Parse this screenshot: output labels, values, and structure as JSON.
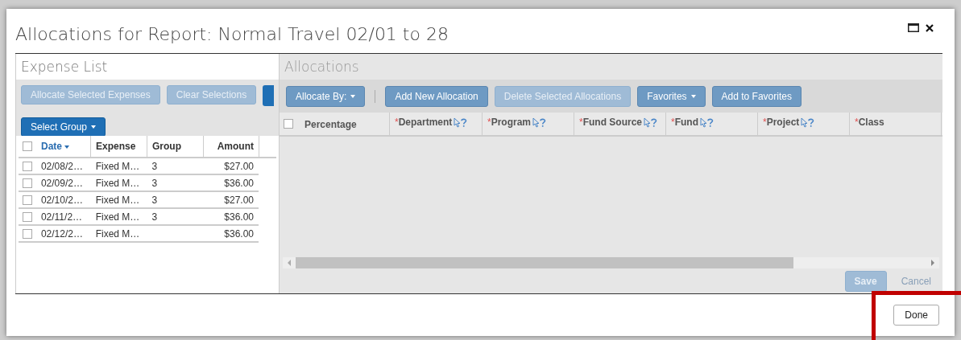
{
  "dialog": {
    "title": "Allocations for Report: Normal Travel 02/01 to 28",
    "expense_list": {
      "heading": "Expense List",
      "buttons": [
        {
          "label": "Allocate Selected Expenses",
          "disabled": true
        },
        {
          "label": "Clear Selections",
          "disabled": true
        }
      ],
      "select_group": {
        "label": "Select Group"
      },
      "all_checked": false,
      "columns": [
        {
          "label": "Date",
          "sorted": true
        },
        {
          "label": "Expense",
          "sorted": false
        },
        {
          "label": "Group",
          "sorted": false
        },
        {
          "label": "Amount",
          "sorted": false
        }
      ],
      "rows": [
        {
          "checked": false,
          "cells": [
            "02/08/2…",
            "Fixed M…",
            "3",
            "$27.00"
          ]
        },
        {
          "checked": false,
          "cells": [
            "02/09/2…",
            "Fixed M…",
            "3",
            "$36.00"
          ]
        },
        {
          "checked": false,
          "cells": [
            "02/10/2…",
            "Fixed M…",
            "3",
            "$27.00"
          ]
        },
        {
          "checked": false,
          "cells": [
            "02/11/2…",
            "Fixed M…",
            "3",
            "$36.00"
          ]
        },
        {
          "checked": false,
          "cells": [
            "02/12/2…",
            "Fixed M…",
            "",
            "$36.00"
          ]
        }
      ]
    },
    "allocations": {
      "heading": "Allocations",
      "toolbar": [
        {
          "kind": "dropdown",
          "label": "Allocate By:",
          "disabled": false,
          "separator_after": true
        },
        {
          "kind": "button",
          "label": "Add New Allocation",
          "disabled": false,
          "separator_after": false
        },
        {
          "kind": "button",
          "label": "Delete Selected Allocations",
          "disabled": true,
          "separator_after": false
        },
        {
          "kind": "dropdown",
          "label": "Favorites",
          "disabled": false,
          "separator_after": false
        },
        {
          "kind": "button",
          "label": "Add to Favorites",
          "disabled": false,
          "separator_after": false
        }
      ],
      "all_checked": false,
      "columns": [
        {
          "label": "Percentage",
          "help": false
        },
        {
          "marker": "*",
          "label": "Department",
          "help": true
        },
        {
          "marker": "*",
          "label": "Program",
          "help": true
        },
        {
          "marker": "*",
          "label": "Fund Source",
          "help": true
        },
        {
          "marker": "*",
          "label": "Fund",
          "help": true
        },
        {
          "marker": "*",
          "label": "Project",
          "help": true
        },
        {
          "marker": "*",
          "label": "Class",
          "help": false
        }
      ],
      "save": {
        "label": "Save",
        "disabled": true
      },
      "cancel": {
        "label": "Cancel"
      }
    },
    "done": {
      "label": "Done"
    }
  }
}
